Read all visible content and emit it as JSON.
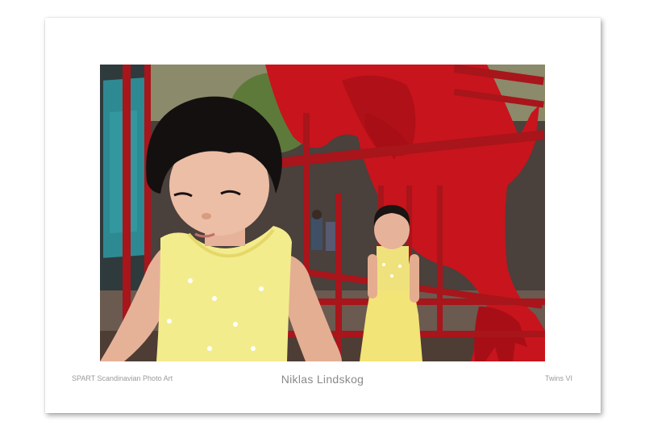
{
  "print": {
    "publisher": "SPART Scandinavian Photo Art",
    "artist": "Niklas Lindskog",
    "title": "Twins VI"
  },
  "photo": {
    "subject": "two toddlers in yellow dresses in front of a red dinosaur sculpture behind red railings",
    "colors": {
      "dinosaur": "#c8141c",
      "railing": "#a8151b",
      "dress": "#f3e88a",
      "hair": "#141010",
      "skin": "#e7b79a"
    }
  }
}
